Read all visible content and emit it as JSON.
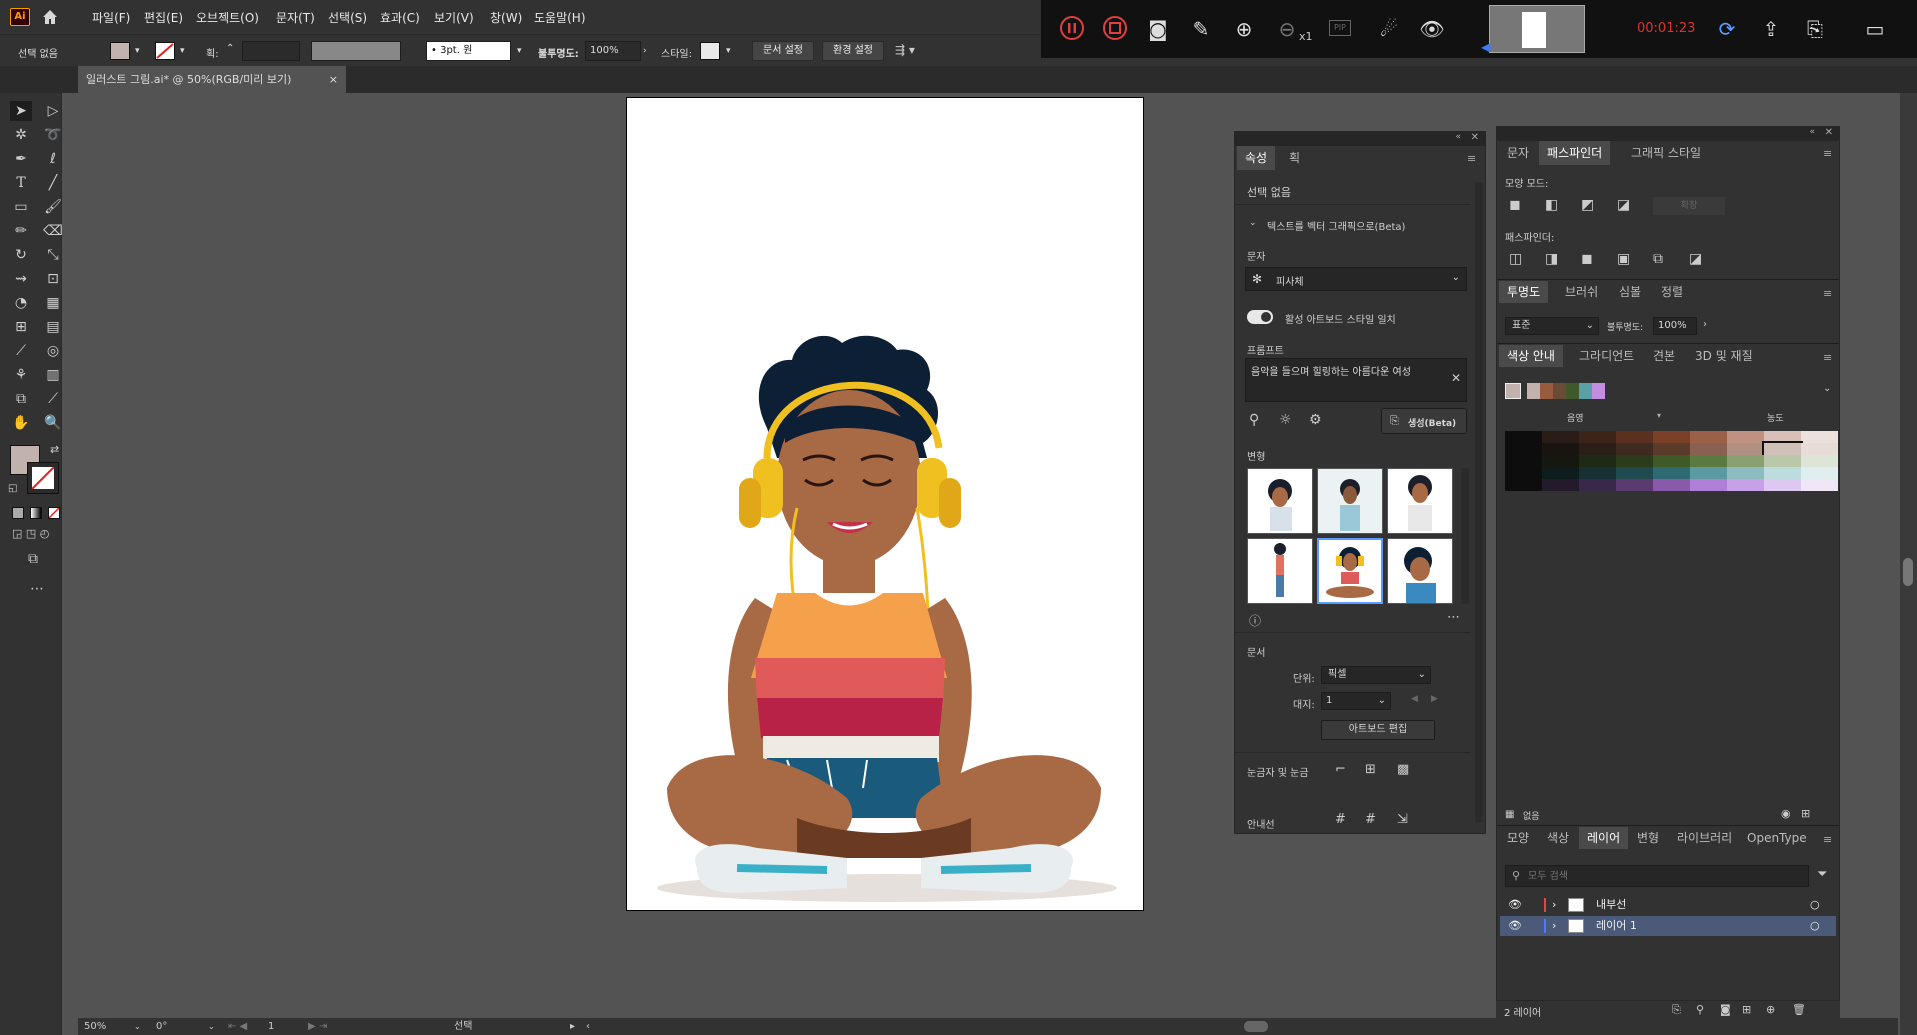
{
  "app": {
    "logo": "Ai"
  },
  "menu": [
    "파일(F)",
    "편집(E)",
    "오브젝트(O)",
    "문자(T)",
    "선택(S)",
    "효과(C)",
    "보기(V)",
    "창(W)",
    "도움말(H)"
  ],
  "control": {
    "selection": "선택 없음",
    "stroke_label": "획:",
    "brush": "3pt. 원",
    "opacity_label": "불투명도:",
    "opacity": "100%",
    "style_label": "스타일:",
    "doc_setup": "문서 설정",
    "preferences": "환경 설정"
  },
  "doc_tab": {
    "title": "일러스트 그림.ai* @ 50%(RGB/미리 보기)",
    "close": "×"
  },
  "recorder": {
    "time": "00:01:23",
    "zoom_suffix": "x1",
    "pip": "PIP"
  },
  "properties": {
    "tabs": [
      "속성",
      "획"
    ],
    "selection": "선택 없음",
    "section_title": "텍스트를 벡터 그래픽으로(Beta)",
    "type_label": "문자",
    "type_value": "피사체",
    "toggle_label": "활성 아트보드 스타일 일치",
    "prompt_label": "프롬프트",
    "prompt_text": "음악을 들으며 힐링하는 아름다운  여성",
    "generate": "생성(Beta)",
    "variations_label": "변형",
    "document_label": "문서",
    "unit_label": "단위:",
    "unit_value": "픽셀",
    "artboard_label": "대지:",
    "artboard_value": "1",
    "edit_artboards": "아트보드 편집",
    "rulers_label": "눈금자 및 눈금",
    "guides_label": "안내선"
  },
  "pathfinder": {
    "tabs": [
      "문자",
      "패스파인더",
      "그래픽 스타일"
    ],
    "shape_modes": "모양 모드:",
    "expand": "확장",
    "pathfinders": "패스파인더:"
  },
  "transparency": {
    "tabs": [
      "투명도",
      "브러쉬",
      "심볼",
      "정렬"
    ],
    "mode": "표준",
    "opacity_label": "불투명도:",
    "opacity": "100%"
  },
  "color_guide": {
    "tabs": [
      "색상 안내",
      "그라디언트",
      "견본",
      "3D 및 재질"
    ],
    "shade_label": "음영",
    "tint_label": "농도",
    "harmony": [
      "#c2b2ae",
      "#9a5a3e",
      "#6b4a36",
      "#3f5a2a",
      "#5aa0a6",
      "#c48ee0"
    ],
    "grid": [
      [
        "#0d0d0d",
        "#2a1c16",
        "#3c2418",
        "#5a3020",
        "#7a4028",
        "#9a6048",
        "#c09080",
        "#d8c0b8",
        "#ece0dc"
      ],
      [
        "#0d0d0d",
        "#1a1411",
        "#2a1f18",
        "#3f2a1f",
        "#5a3a28",
        "#8a6050",
        "#b09080",
        "#d0c0b8",
        "#e8dcd8"
      ],
      [
        "#0d0d0d",
        "#15180f",
        "#1f2a14",
        "#2a3c1a",
        "#3f5a26",
        "#5a7a40",
        "#8aa070",
        "#b8c8a8",
        "#dde6d6"
      ],
      [
        "#0d0d0d",
        "#0f1c1e",
        "#163034",
        "#1f4a50",
        "#2e6a72",
        "#5a9aa0",
        "#8cbcc0",
        "#bcdcde",
        "#e0eeef"
      ],
      [
        "#0d0d0d",
        "#231a2c",
        "#3a2848",
        "#5a3a70",
        "#8a5aaa",
        "#b080d8",
        "#c8a0e8",
        "#dcc8f0",
        "#efe6f8"
      ]
    ],
    "none_label": "없음"
  },
  "layers": {
    "tabs": [
      "모양",
      "색상",
      "레이어",
      "변형",
      "라이브러리",
      "OpenType"
    ],
    "search_placeholder": "모두 검색",
    "items": [
      {
        "name": "내부선",
        "color": "#e04848"
      },
      {
        "name": "레이어 1",
        "color": "#4a7aff"
      }
    ],
    "count": "2 레이어"
  },
  "status": {
    "zoom": "50%",
    "angle": "0°",
    "page": "1",
    "tool": "선택"
  }
}
